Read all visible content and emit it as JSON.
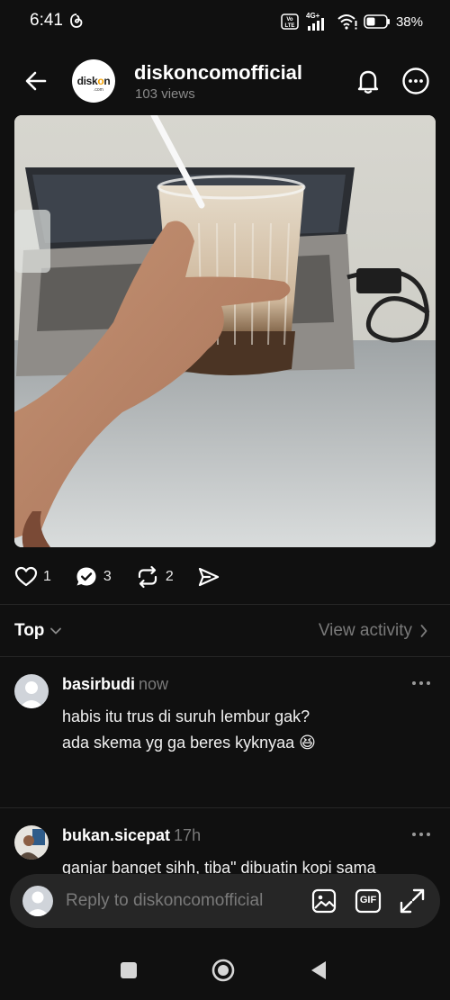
{
  "status_bar": {
    "time": "6:41",
    "network": "4G+",
    "volte": "Vo LTE",
    "battery": "38%"
  },
  "header": {
    "username": "diskoncomofficial",
    "views": "103 views",
    "avatar_logo_start": "disk",
    "avatar_logo_o": "o",
    "avatar_logo_end": "n",
    "avatar_logo_suffix": ".com"
  },
  "post": {
    "likes": "1",
    "replies": "3",
    "reposts": "2"
  },
  "sort": {
    "label": "Top",
    "view_activity": "View activity"
  },
  "comments": [
    {
      "username": "basirbudi",
      "time": "now",
      "lines": [
        "habis itu trus di suruh lembur gak?",
        "ada skema yg ga beres kyknyaa 😆"
      ]
    },
    {
      "username": "bukan.sicepat",
      "time": "17h",
      "lines": [
        "ganjar banget sihh, tiba\" dibuatin kopi sama"
      ]
    }
  ],
  "reply": {
    "placeholder": "Reply to diskoncomofficial",
    "gif_label": "GIF"
  },
  "colors": {
    "background": "#101010",
    "surface": "#262626",
    "text_primary": "#f3f5f7",
    "text_muted": "#7a7a7a",
    "logo_accent": "#f5a100"
  },
  "icons": {
    "back": "arrow-left-icon",
    "bell": "bell-icon",
    "more": "more-circle-icon",
    "like": "heart-icon",
    "reply": "speech-bubble-icon",
    "repost": "repost-icon",
    "share": "send-icon",
    "image": "image-icon",
    "gif": "gif-icon",
    "expand": "expand-icon"
  }
}
